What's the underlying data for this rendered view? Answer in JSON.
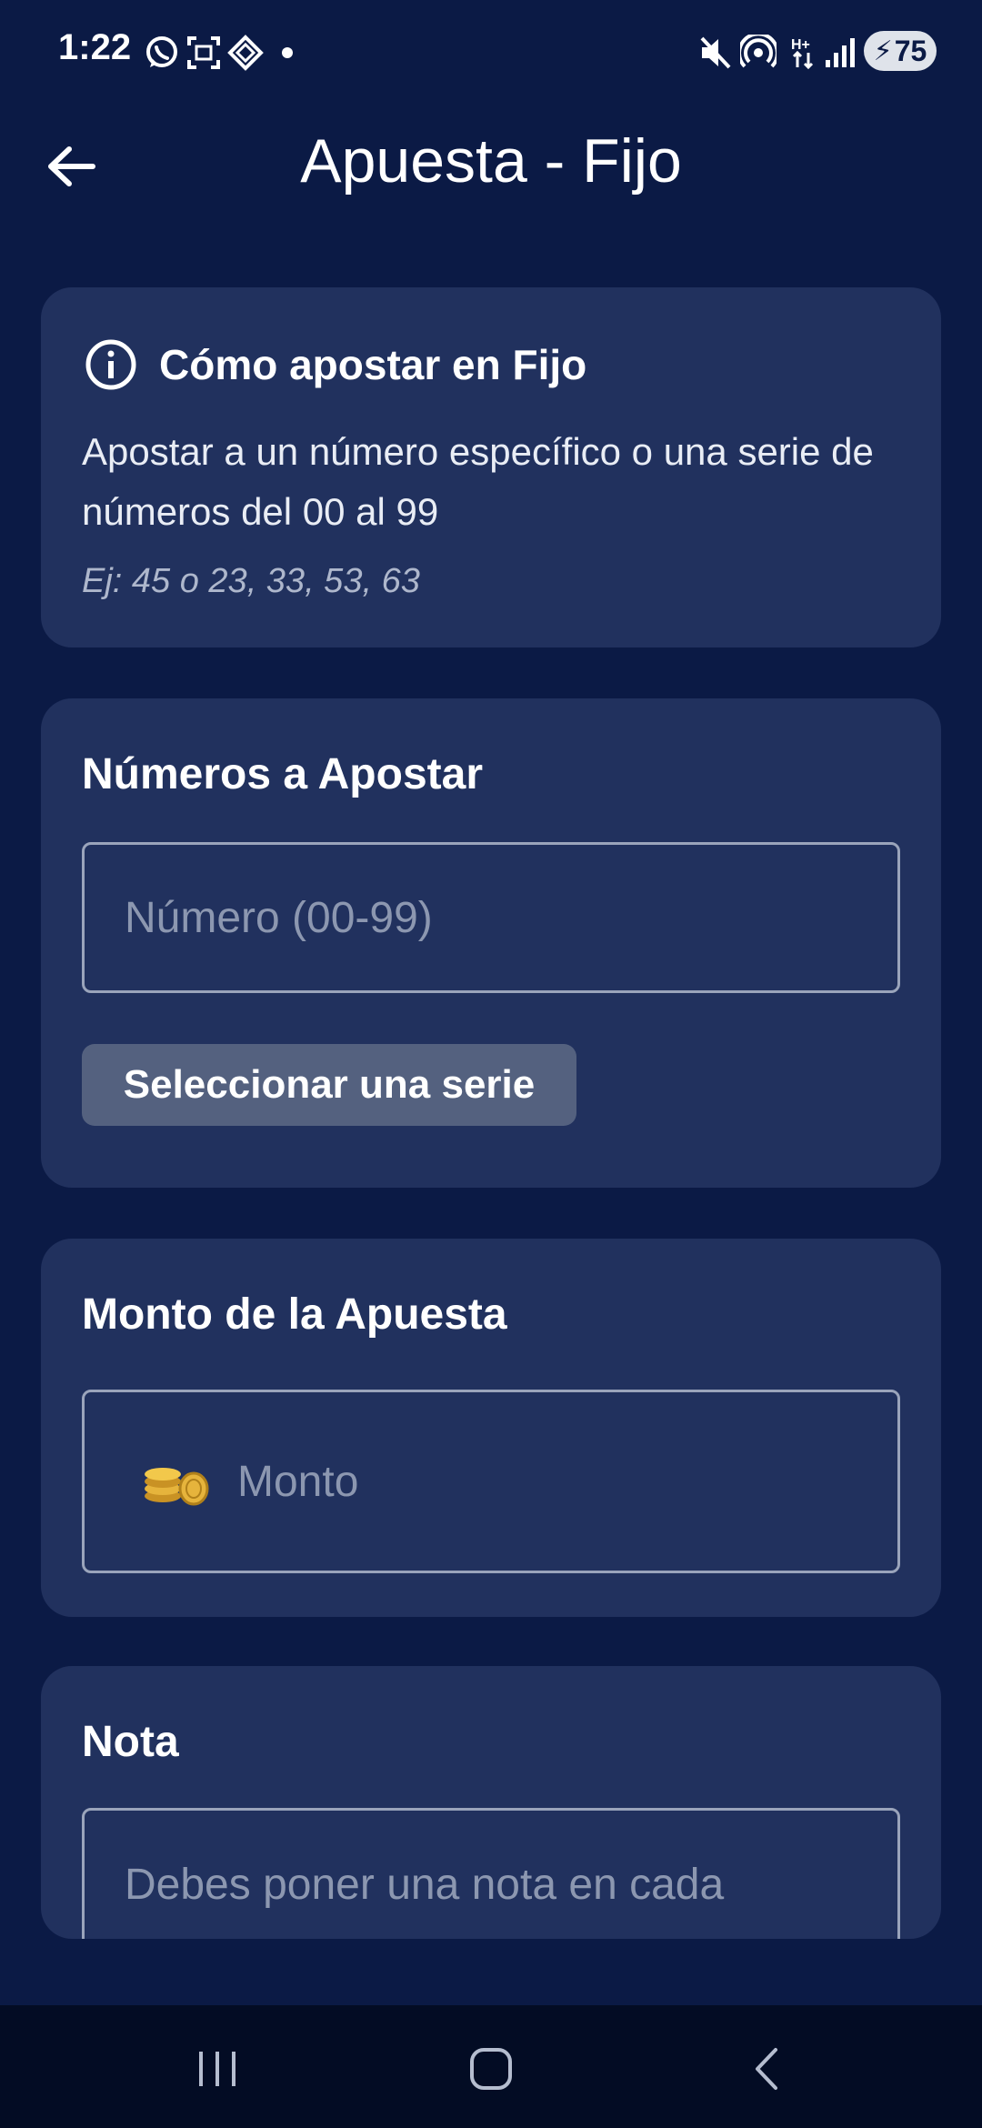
{
  "status_bar": {
    "time": "1:22",
    "battery": "75",
    "left_icons": [
      "whatsapp-icon",
      "screenshot-icon",
      "app-notification-icon"
    ],
    "right_icons": [
      "mute-icon",
      "hotspot-icon",
      "hplus-data-icon",
      "signal-icon",
      "battery-charging-icon"
    ]
  },
  "header": {
    "title": "Apuesta - Fijo",
    "back_icon": "arrow-left-icon"
  },
  "info_card": {
    "title": "Cómo apostar en Fijo",
    "description": "Apostar a un número específico o una serie de números del 00 al 99",
    "example": "Ej: 45 o 23, 33, 53, 63",
    "icon": "info-icon"
  },
  "numbers_card": {
    "title": "Números a Apostar",
    "input_placeholder": "Número (00-99)",
    "series_button_label": "Seleccionar una serie"
  },
  "amount_card": {
    "title": "Monto de la Apuesta",
    "input_placeholder": "Monto",
    "input_icon": "coins-icon"
  },
  "note_card": {
    "title": "Nota",
    "input_placeholder": "Debes poner una nota en cada"
  },
  "nav_bar": {
    "icons": [
      "recent-apps-icon",
      "home-icon",
      "back-icon"
    ]
  },
  "colors": {
    "background": "#0b1a45",
    "card": "#21315e",
    "button": "#54617f",
    "nav_bar": "#030c24",
    "coin": "#e6b43c"
  }
}
